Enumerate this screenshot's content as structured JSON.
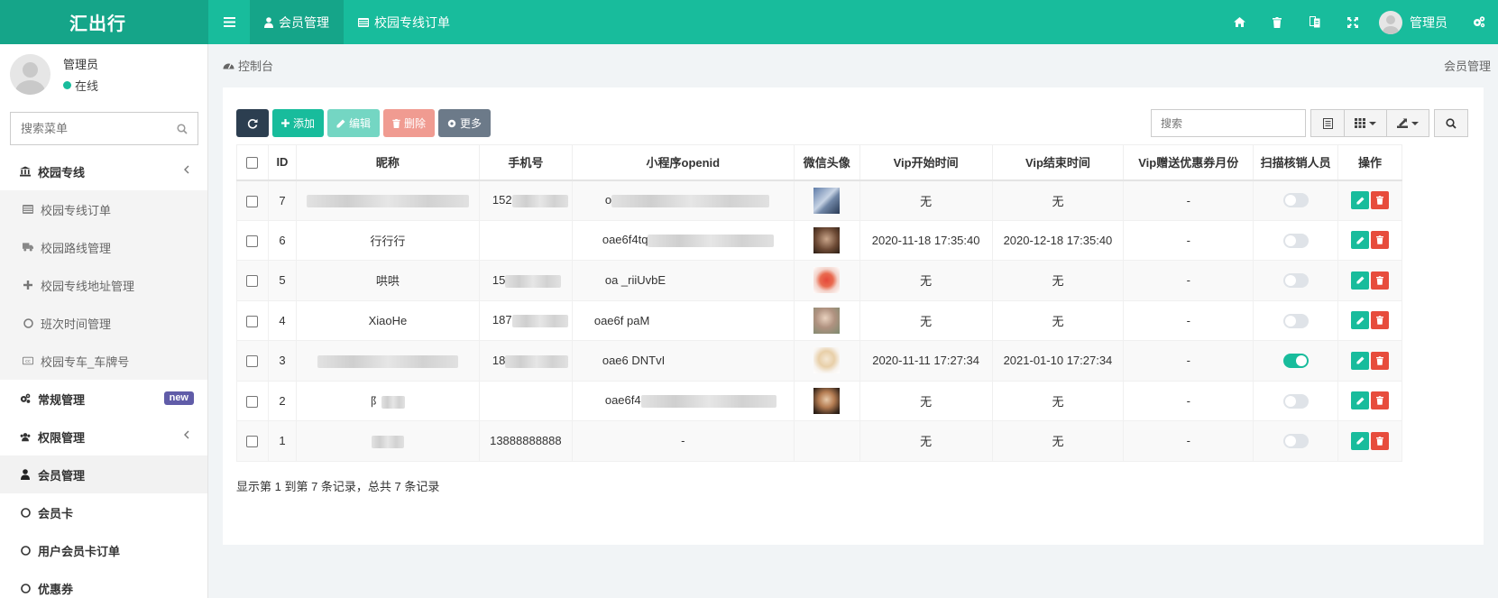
{
  "app": {
    "logo": "汇出行",
    "tabs": [
      {
        "label": "会员管理",
        "icon": "user-icon"
      },
      {
        "label": "校园专线订单",
        "icon": "list-icon"
      }
    ],
    "header_user": "管理员",
    "header_icons": [
      "home-icon",
      "trash-icon",
      "translate-icon",
      "fullscreen-icon",
      "settings-cogs-icon"
    ]
  },
  "sidebar": {
    "user_name": "管理员",
    "user_status": "在线",
    "search_placeholder": "搜索菜单",
    "items": [
      {
        "label": "校园专线",
        "icon": "bank-icon",
        "type": "group"
      },
      {
        "label": "校园专线订单",
        "icon": "list-icon",
        "type": "sub"
      },
      {
        "label": "校园路线管理",
        "icon": "truck-icon",
        "type": "sub"
      },
      {
        "label": "校园专线地址管理",
        "icon": "plus-icon",
        "type": "sub"
      },
      {
        "label": "班次时间管理",
        "icon": "circle-icon",
        "type": "sub"
      },
      {
        "label": "校园专车_车牌号",
        "icon": "cc-icon",
        "type": "sub"
      },
      {
        "label": "常规管理",
        "icon": "cogs-icon",
        "type": "group",
        "badge": "new"
      },
      {
        "label": "权限管理",
        "icon": "group-icon",
        "type": "group"
      },
      {
        "label": "会员管理",
        "icon": "user-icon",
        "type": "top"
      },
      {
        "label": "会员卡",
        "icon": "circle-icon",
        "type": "top"
      },
      {
        "label": "用户会员卡订单",
        "icon": "circle-icon",
        "type": "top"
      },
      {
        "label": "优惠券",
        "icon": "circle-icon",
        "type": "top"
      }
    ]
  },
  "breadcrumb": {
    "left": "控制台",
    "right": "会员管理"
  },
  "toolbar": {
    "add": "添加",
    "edit": "编辑",
    "delete": "删除",
    "more": "更多",
    "search_placeholder": "搜索"
  },
  "table": {
    "headers": [
      "ID",
      "昵称",
      "手机号",
      "小程序openid",
      "微信头像",
      "Vip开始时间",
      "Vip结束时间",
      "Vip赠送优惠券月份",
      "扫描核销人员",
      "操作"
    ],
    "rows": [
      {
        "id": "7",
        "nickname": "",
        "phone": "152",
        "openid": "o",
        "vip_start": "无",
        "vip_end": "无",
        "coupon_month": "-",
        "scanner": false
      },
      {
        "id": "6",
        "nickname": "行行行",
        "phone": "",
        "openid": "oae6f4tq",
        "vip_start": "2020-11-18 17:35:40",
        "vip_end": "2020-12-18 17:35:40",
        "coupon_month": "-",
        "scanner": false
      },
      {
        "id": "5",
        "nickname": "哄哄",
        "phone": "15",
        "openid": "oa  _riiUvbE",
        "vip_start": "无",
        "vip_end": "无",
        "coupon_month": "-",
        "scanner": false
      },
      {
        "id": "4",
        "nickname": "XiaoHe",
        "phone": "187",
        "openid": "oae6f  paM",
        "vip_start": "无",
        "vip_end": "无",
        "coupon_month": "-",
        "scanner": false
      },
      {
        "id": "3",
        "nickname": "",
        "phone": "18",
        "openid": "oae6  DNTvI",
        "vip_start": "2020-11-11 17:27:34",
        "vip_end": "2021-01-10 17:27:34",
        "coupon_month": "-",
        "scanner": true
      },
      {
        "id": "2",
        "nickname": "阝",
        "phone": "",
        "openid": "oae6f4",
        "vip_start": "无",
        "vip_end": "无",
        "coupon_month": "-",
        "scanner": false
      },
      {
        "id": "1",
        "nickname": "",
        "phone": "13888888888",
        "openid": "-",
        "vip_start": "无",
        "vip_end": "无",
        "coupon_month": "-",
        "scanner": false
      }
    ]
  },
  "pager_text": "显示第 1 到第 7 条记录，总共 7 条记录",
  "colors": {
    "primary": "#18bc9c",
    "primary_dark": "#15a589",
    "danger": "#e74c3c",
    "dark": "#2c3e50",
    "badge": "#605ca8"
  }
}
